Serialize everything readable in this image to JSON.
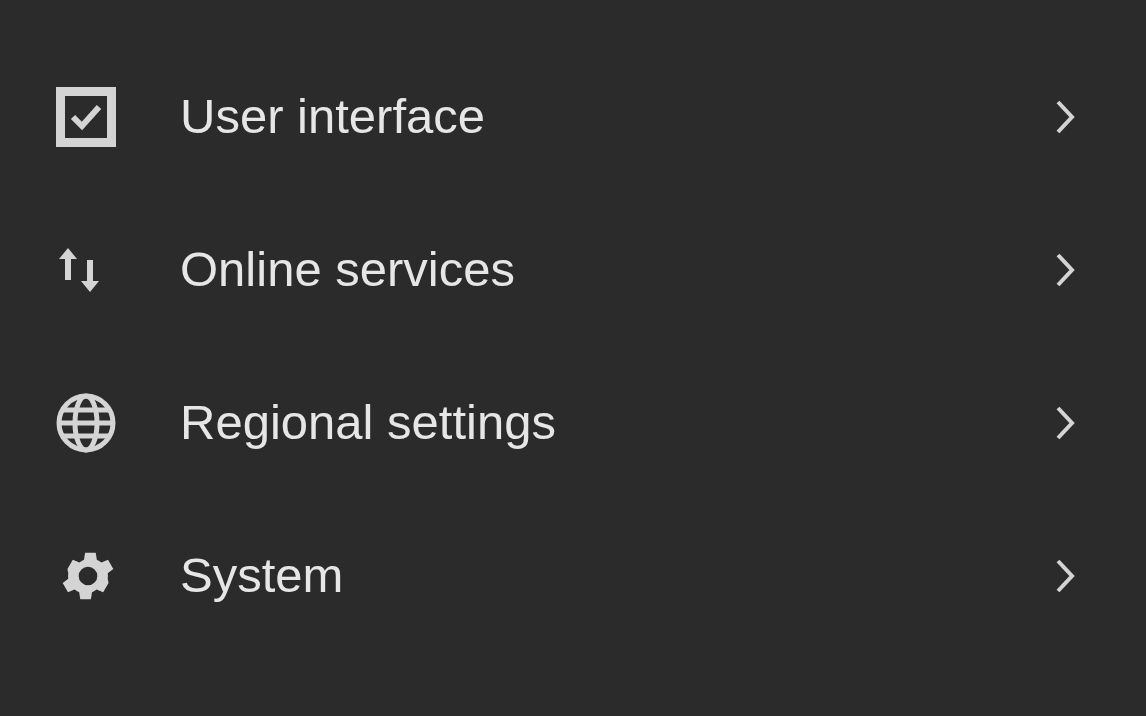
{
  "menu": {
    "items": [
      {
        "label": "User interface"
      },
      {
        "label": "Online services"
      },
      {
        "label": "Regional settings"
      },
      {
        "label": "System"
      }
    ]
  }
}
